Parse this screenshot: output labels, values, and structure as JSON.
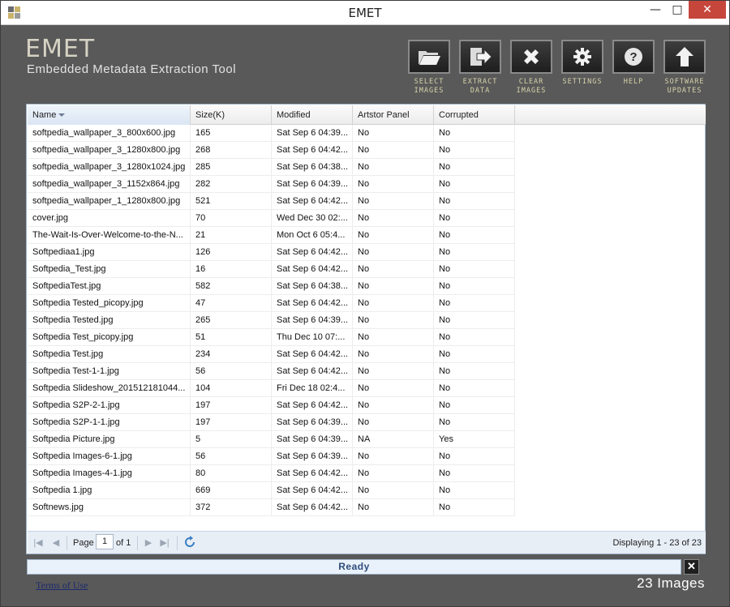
{
  "window": {
    "title": "EMET",
    "minimize": "—",
    "maximize": "□",
    "close": "✕"
  },
  "brand": {
    "name": "EMET",
    "subtitle": "Embedded Metadata Extraction Tool"
  },
  "toolbar": [
    {
      "line1": "SELECT",
      "line2": "IMAGES",
      "icon": "folder-open-icon"
    },
    {
      "line1": "EXTRACT",
      "line2": "DATA",
      "icon": "export-arrow-icon"
    },
    {
      "line1": "CLEAR",
      "line2": "IMAGES",
      "icon": "clear-x-icon"
    },
    {
      "line1": "SETTINGS",
      "line2": "",
      "icon": "gear-icon"
    },
    {
      "line1": "HELP",
      "line2": "",
      "icon": "help-icon"
    },
    {
      "line1": "SOFTWARE",
      "line2": "UPDATES",
      "icon": "upload-arrow-icon"
    }
  ],
  "table": {
    "columns": [
      "Name",
      "Size(K)",
      "Modified",
      "Artstor Panel",
      "Corrupted"
    ],
    "sorted_column": "Name",
    "rows": [
      [
        "softpedia_wallpaper_3_800x600.jpg",
        "165",
        "Sat Sep 6 04:39...",
        "No",
        "No"
      ],
      [
        "softpedia_wallpaper_3_1280x800.jpg",
        "268",
        "Sat Sep 6 04:42...",
        "No",
        "No"
      ],
      [
        "softpedia_wallpaper_3_1280x1024.jpg",
        "285",
        "Sat Sep 6 04:38...",
        "No",
        "No"
      ],
      [
        "softpedia_wallpaper_3_1152x864.jpg",
        "282",
        "Sat Sep 6 04:39...",
        "No",
        "No"
      ],
      [
        "softpedia_wallpaper_1_1280x800.jpg",
        "521",
        "Sat Sep 6 04:42...",
        "No",
        "No"
      ],
      [
        "cover.jpg",
        "70",
        "Wed Dec 30 02:...",
        "No",
        "No"
      ],
      [
        "The-Wait-Is-Over-Welcome-to-the-N...",
        "21",
        "Mon Oct 6 05:4...",
        "No",
        "No"
      ],
      [
        "Softpediaa1.jpg",
        "126",
        "Sat Sep 6 04:42...",
        "No",
        "No"
      ],
      [
        "Softpedia_Test.jpg",
        "16",
        "Sat Sep 6 04:42...",
        "No",
        "No"
      ],
      [
        "SoftpediaTest.jpg",
        "582",
        "Sat Sep 6 04:38...",
        "No",
        "No"
      ],
      [
        "Softpedia Tested_picopy.jpg",
        "47",
        "Sat Sep 6 04:42...",
        "No",
        "No"
      ],
      [
        "Softpedia Tested.jpg",
        "265",
        "Sat Sep 6 04:39...",
        "No",
        "No"
      ],
      [
        "Softpedia Test_picopy.jpg",
        "51",
        "Thu Dec 10 07:...",
        "No",
        "No"
      ],
      [
        "Softpedia Test.jpg",
        "234",
        "Sat Sep 6 04:42...",
        "No",
        "No"
      ],
      [
        "Softpedia Test-1-1.jpg",
        "56",
        "Sat Sep 6 04:42...",
        "No",
        "No"
      ],
      [
        "Softpedia Slideshow_201512181044...",
        "104",
        "Fri Dec 18 02:4...",
        "No",
        "No"
      ],
      [
        "Softpedia S2P-2-1.jpg",
        "197",
        "Sat Sep 6 04:42...",
        "No",
        "No"
      ],
      [
        "Softpedia S2P-1-1.jpg",
        "197",
        "Sat Sep 6 04:39...",
        "No",
        "No"
      ],
      [
        "Softpedia Picture.jpg",
        "5",
        "Sat Sep 6 04:39...",
        "NA",
        "Yes"
      ],
      [
        "Softpedia Images-6-1.jpg",
        "56",
        "Sat Sep 6 04:39...",
        "No",
        "No"
      ],
      [
        "Softpedia Images-4-1.jpg",
        "80",
        "Sat Sep 6 04:42...",
        "No",
        "No"
      ],
      [
        "Softpedia 1.jpg",
        "669",
        "Sat Sep 6 04:42...",
        "No",
        "No"
      ],
      [
        "Softnews.jpg",
        "372",
        "Sat Sep 6 04:42...",
        "No",
        "No"
      ]
    ]
  },
  "pager": {
    "page_label": "Page",
    "page_value": "1",
    "of_label": "of 1",
    "display_text": "Displaying 1 - 23 of 23"
  },
  "status": {
    "text": "Ready",
    "close": "✕"
  },
  "footer": {
    "terms": "Terms of Use",
    "count": "23 Images"
  },
  "colors": {
    "chrome": "#595959",
    "accent": "#2e4d7c",
    "label": "#d6d2a9",
    "close_button": "#c7463c"
  }
}
